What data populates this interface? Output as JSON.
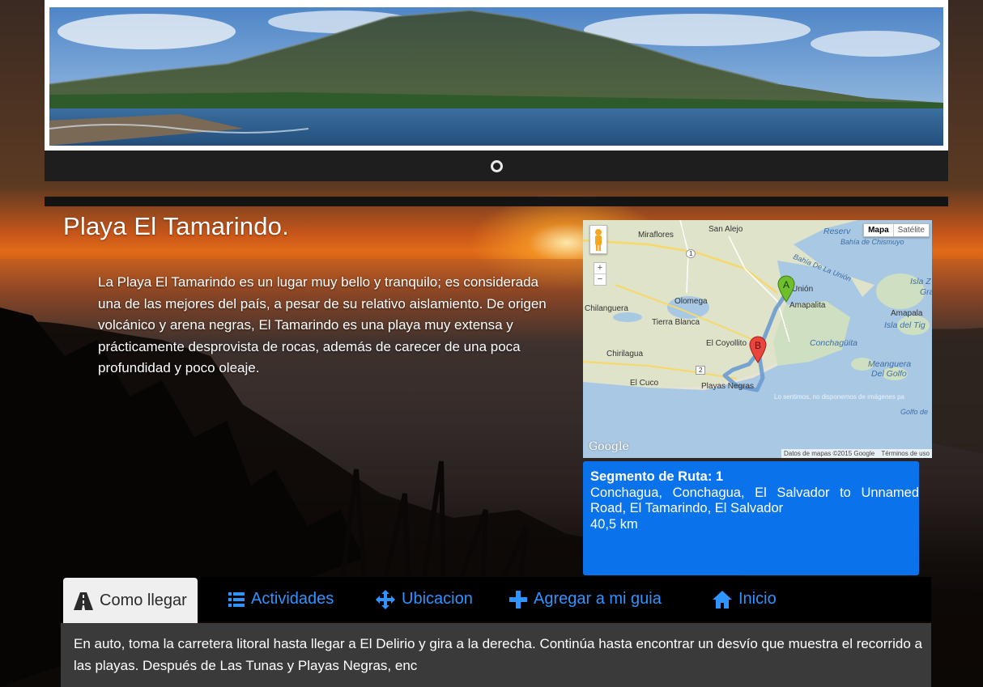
{
  "page": {
    "title": "Playa El Tamarindo.",
    "description": "La Playa El Tamarindo es un lugar muy bello y tranquilo; es considerada una de las mejores del país, a pesar de su relativo aislamiento. De origen volcánico y arena negras, El Tamarindo es una playa muy extensa y prácticamente desprovista de rocas, además de carecer de una poca profundidad y poco oleaje."
  },
  "map": {
    "type_buttons": [
      "Mapa",
      "Satélite"
    ],
    "zoom_in": "+",
    "zoom_out": "−",
    "labels": {
      "miraflores": "Miraflores",
      "san_alejo": "San Alejo",
      "reserva": "Reserv",
      "bahia_chismuyo": "Bahía de Chismuyo",
      "bahia_union": "Bahía De La Unión",
      "union": "Unión",
      "isla_z": "Isla Z",
      "gra": "Gra",
      "chilanguera": "Chilanguera",
      "olomega": "Olomega",
      "amapalita": "Amapalita",
      "amapala": "Amapala",
      "isla_tig": "Isla del Tig",
      "tierra_blanca": "Tierra Blanca",
      "el_coyollito": "El Coyollito",
      "conchaguita": "Conchagüita",
      "chirilagua": "Chirilagua",
      "meanguera": "Meanguera",
      "del_golfo": "Del Golfo",
      "el_cuco": "El Cuco",
      "playas_negras": "Playas Negras",
      "golfo": "Golfo de",
      "route_1": "1",
      "route_2": "2"
    },
    "notice": "Lo sentimos, no disponemos de imágenes pa",
    "google": "Google",
    "footer_data": "Datos de mapas ©2015 Google",
    "footer_terms": "Términos de uso",
    "marker_a": "A",
    "marker_b": "B"
  },
  "route": {
    "title": "Segmento de Ruta: 1",
    "text": "Conchagua, Conchagua, El Salvador to Unnamed Road, El Tamarindo, El Salvador",
    "distance": "40,5 km"
  },
  "tabs": [
    {
      "label": "Como llegar",
      "icon": "road-icon",
      "active": true
    },
    {
      "label": "Actividades",
      "icon": "list-icon",
      "active": false
    },
    {
      "label": "Ubicacion",
      "icon": "move-icon",
      "active": false
    },
    {
      "label": "Agregar a mi guia",
      "icon": "plus-icon",
      "active": false
    },
    {
      "label": "Inicio",
      "icon": "home-icon",
      "active": false
    }
  ],
  "tab_content": "En auto, toma la carretera litoral hasta llegar a El Delirio y gira a la derecha. Continúa hasta encontrar un desvío que muestra el recorrido a las playas. Después de Las Tunas y Playas Negras, enc",
  "colors": {
    "tab_link": "#2f94ff",
    "route_box": "#0a72ea",
    "tab_content_bg": "#3a3a3a"
  }
}
